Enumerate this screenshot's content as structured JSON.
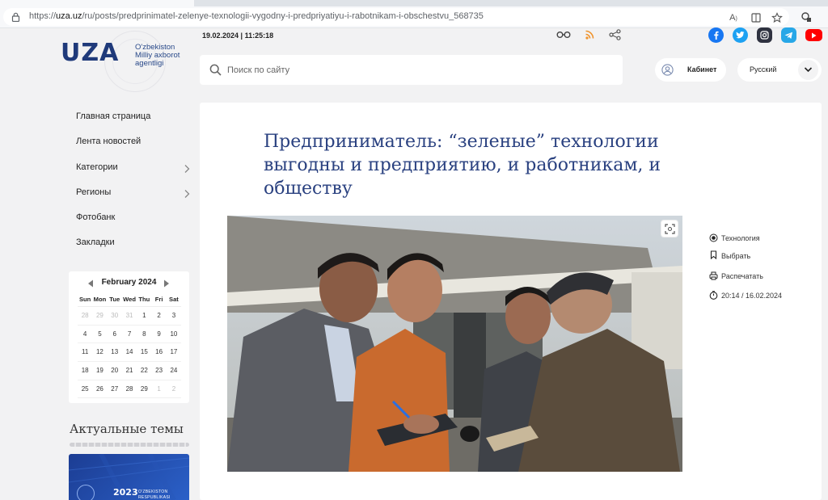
{
  "browser": {
    "url_prefix": "https://",
    "url_host": "uza.uz",
    "url_path": "/ru/posts/predprinimatel-zelenye-texnologii-vygodny-i-predpriyatiyu-i-rabotnikam-i-obschestvu_568735"
  },
  "header": {
    "logo_text": "UZA",
    "logo_sub_1": "O'zbekiston",
    "logo_sub_2": "Milliy axborot",
    "logo_sub_3": "agentligi",
    "datetime": "19.02.2024 | 11:25:18",
    "search_placeholder": "Поиск по сайту",
    "cabinet_label": "Кабинет",
    "language": "Русский",
    "socials": [
      {
        "name": "facebook",
        "color": "#1877f2"
      },
      {
        "name": "twitter",
        "color": "#1da1f2"
      },
      {
        "name": "instagram",
        "color": "#2f3240"
      },
      {
        "name": "telegram",
        "color": "#27a7e7"
      },
      {
        "name": "youtube",
        "color": "#ff0000"
      }
    ]
  },
  "sidebar": {
    "items": [
      {
        "label": "Главная страница",
        "has_submenu": false
      },
      {
        "label": "Лента новостей",
        "has_submenu": false
      },
      {
        "label": "Категории",
        "has_submenu": true
      },
      {
        "label": "Регионы",
        "has_submenu": true
      },
      {
        "label": "Фотобанк",
        "has_submenu": false
      },
      {
        "label": "Закладки",
        "has_submenu": false
      }
    ]
  },
  "calendar": {
    "title": "February 2024",
    "weekdays": [
      "Sun",
      "Mon",
      "Tue",
      "Wed",
      "Thu",
      "Fri",
      "Sat"
    ],
    "weeks": [
      [
        {
          "d": "28",
          "m": true
        },
        {
          "d": "29",
          "m": true
        },
        {
          "d": "30",
          "m": true
        },
        {
          "d": "31",
          "m": true
        },
        {
          "d": "1"
        },
        {
          "d": "2"
        },
        {
          "d": "3"
        }
      ],
      [
        {
          "d": "4"
        },
        {
          "d": "5"
        },
        {
          "d": "6"
        },
        {
          "d": "7"
        },
        {
          "d": "8"
        },
        {
          "d": "9"
        },
        {
          "d": "10"
        }
      ],
      [
        {
          "d": "11"
        },
        {
          "d": "12"
        },
        {
          "d": "13"
        },
        {
          "d": "14"
        },
        {
          "d": "15"
        },
        {
          "d": "16"
        },
        {
          "d": "17"
        }
      ],
      [
        {
          "d": "18"
        },
        {
          "d": "19"
        },
        {
          "d": "20"
        },
        {
          "d": "21"
        },
        {
          "d": "22"
        },
        {
          "d": "23"
        },
        {
          "d": "24"
        }
      ],
      [
        {
          "d": "25"
        },
        {
          "d": "26"
        },
        {
          "d": "27"
        },
        {
          "d": "28"
        },
        {
          "d": "29"
        },
        {
          "d": "1",
          "m": true
        },
        {
          "d": "2",
          "m": true
        }
      ]
    ]
  },
  "topics": {
    "title": "Актуальные темы",
    "banner_year": "2023",
    "banner_line_1": "O'ZBEKISTON",
    "banner_line_2": "RESPUBLIKASI"
  },
  "article": {
    "headline": "Предприниматель: “зеленые” технологии выгодны и предприятию, и работникам, и обществу",
    "category": "Технология",
    "select_label": "Выбрать",
    "print_label": "Распечатать",
    "published": "20:14 / 16.02.2024"
  },
  "colors": {
    "accent_navy": "#2a4180",
    "logo_navy": "#1f3a7a",
    "rss_orange": "#f0932b"
  }
}
